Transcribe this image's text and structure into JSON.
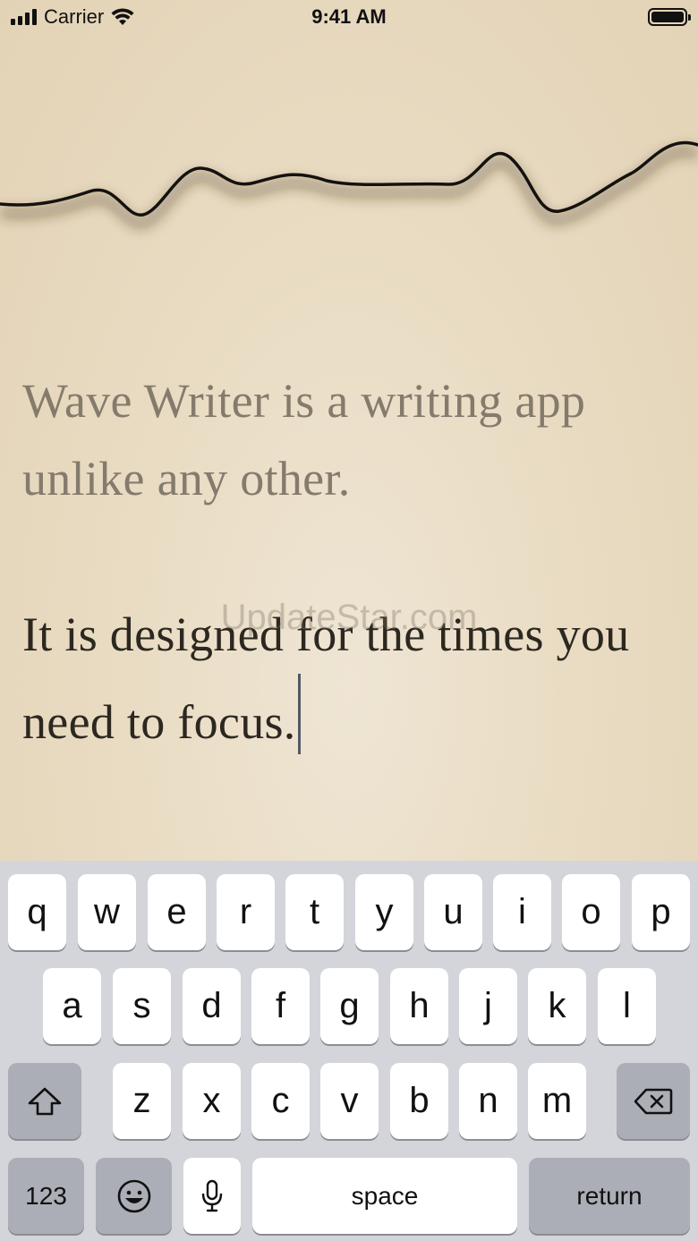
{
  "status_bar": {
    "carrier": "Carrier",
    "time": "9:41 AM"
  },
  "editor": {
    "paragraph_1": "Wave Writer is a writing app unlike any other.",
    "paragraph_2": "It is designed for the times you need to focus."
  },
  "watermark": "UpdateStar.com",
  "keyboard": {
    "row1": [
      "q",
      "w",
      "e",
      "r",
      "t",
      "y",
      "u",
      "i",
      "o",
      "p"
    ],
    "row2": [
      "a",
      "s",
      "d",
      "f",
      "g",
      "h",
      "j",
      "k",
      "l"
    ],
    "row3": [
      "z",
      "x",
      "c",
      "v",
      "b",
      "n",
      "m"
    ],
    "numbers_label": "123",
    "space_label": "space",
    "return_label": "return"
  },
  "icons": [
    "cellular-signal-icon",
    "wifi-icon",
    "battery-icon",
    "shift-icon",
    "delete-icon",
    "emoji-icon",
    "microphone-icon"
  ],
  "colors": {
    "background": "#e9dcc3",
    "text_dim": "#857b6d",
    "text_active": "#2c2820",
    "caret": "#4f5a63",
    "keyboard_bg": "#d3d5db",
    "key_dark": "#abaeb6"
  }
}
